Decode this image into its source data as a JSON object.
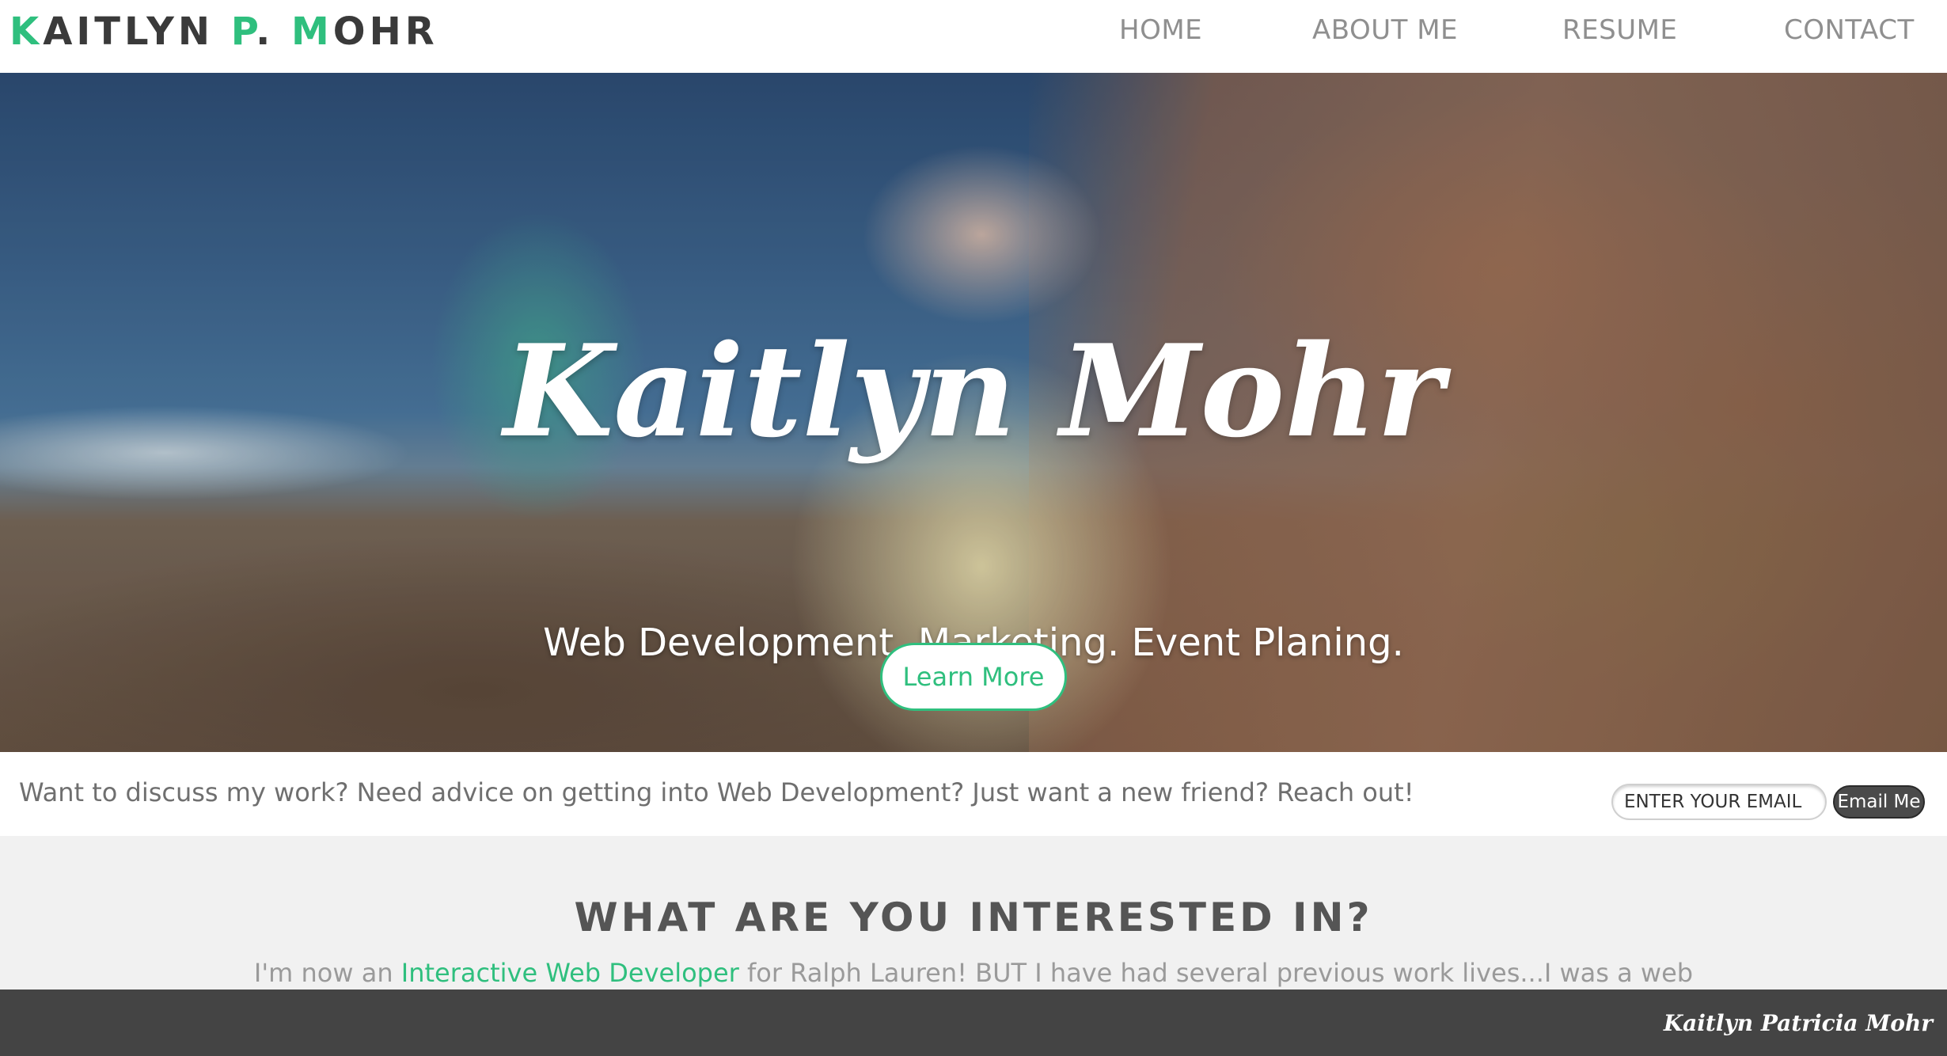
{
  "brand": {
    "parts": [
      {
        "text": "K",
        "accent": true
      },
      {
        "text": "AITLYN ",
        "accent": false
      },
      {
        "text": "P",
        "accent": true
      },
      {
        "text": ". ",
        "accent": false
      },
      {
        "text": "M",
        "accent": true
      },
      {
        "text": "OHR",
        "accent": false
      }
    ]
  },
  "nav": {
    "home": "HOME",
    "about": "ABOUT ME",
    "resume": "RESUME",
    "contact": "CONTACT"
  },
  "hero": {
    "title": "Kaitlyn Mohr",
    "subtitle": "Web Development. Marketing. Event Planing.",
    "cta": "Learn More"
  },
  "email": {
    "prompt": "Want to discuss my work? Need advice on getting into Web Development? Just want a new friend? Reach out!",
    "placeholder": "ENTER YOUR EMAIL",
    "button": "Email Me"
  },
  "interests": {
    "title": "WHAT ARE YOU INTERESTED IN?",
    "body_before": "I'm now an ",
    "body_highlight": "Interactive Web Developer",
    "body_after": " for Ralph Lauren! BUT I have had several previous work lives...I was a web"
  },
  "footer": {
    "signature": "Kaitlyn Patricia Mohr"
  },
  "colors": {
    "accent": "#2fbf7e",
    "footer_bg": "#444444",
    "section_bg": "#f1f1f1"
  }
}
